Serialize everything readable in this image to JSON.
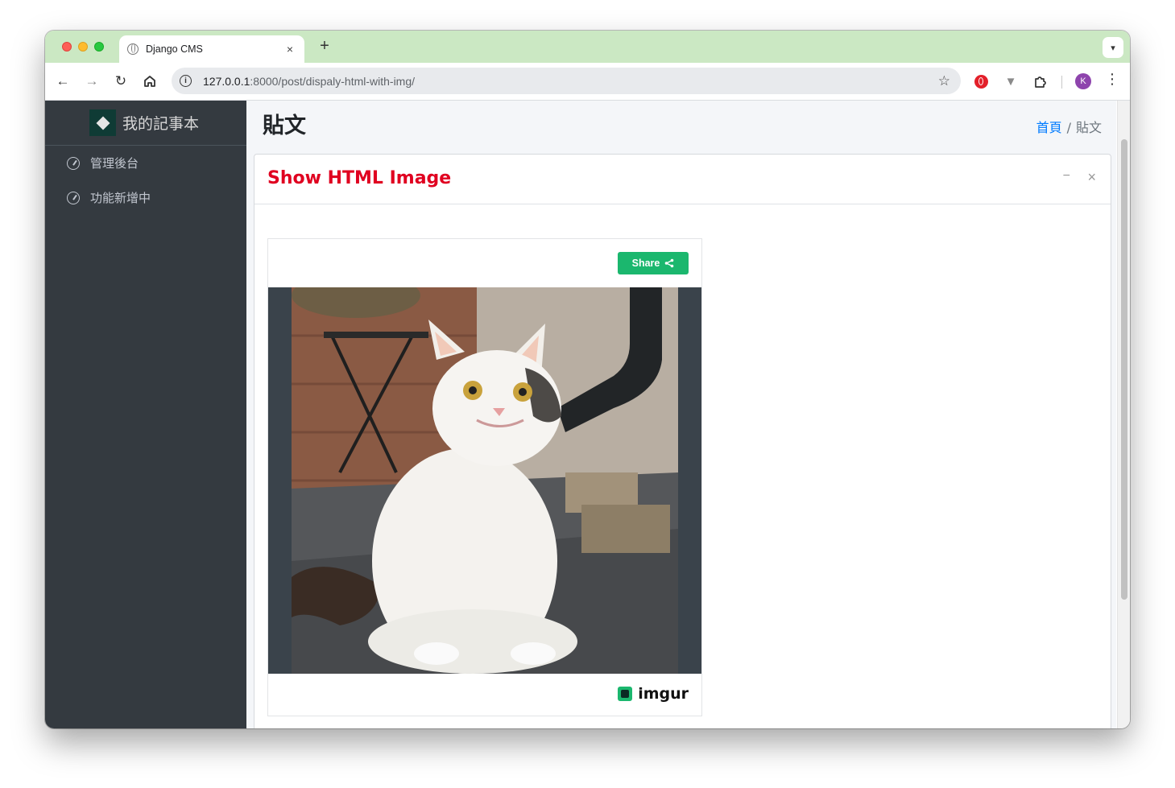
{
  "browser": {
    "tab_title": "Django CMS",
    "tab_close": "×",
    "new_tab": "+",
    "url_host": "127.0.0.1",
    "url_rest": ":8000/post/dispaly-html-with-img/",
    "icons": [
      "back-arrow-icon",
      "forward-arrow-icon",
      "reload-icon",
      "home-icon",
      "info-icon",
      "star-icon",
      "opera-extension-icon",
      "vivaldi-extension-icon",
      "puzzle-icon",
      "kebab-menu-icon"
    ],
    "avatar_letter": "K"
  },
  "sidebar": {
    "brand_text": "我的記事本",
    "items": [
      {
        "label": "管理後台"
      },
      {
        "label": "功能新增中"
      }
    ]
  },
  "page": {
    "title": "貼文",
    "breadcrumb": {
      "home": "首頁",
      "separator": "/",
      "current": "貼文"
    }
  },
  "card": {
    "title": "Show HTML Image",
    "title_color": "#e00020",
    "minimize": "−",
    "close": "×"
  },
  "embed": {
    "share_label": "Share",
    "share_color": "#1bb76e",
    "provider": "imgur"
  }
}
